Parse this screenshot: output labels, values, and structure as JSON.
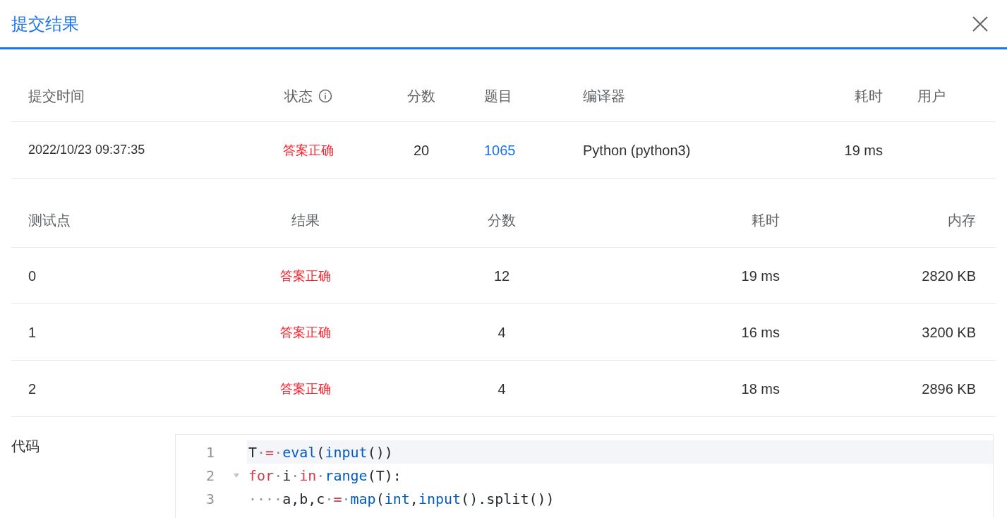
{
  "dialog": {
    "title": "提交结果"
  },
  "submission": {
    "columns": [
      {
        "label": "提交时间",
        "info": false
      },
      {
        "label": "状态",
        "info": true
      },
      {
        "label": "分数",
        "info": false
      },
      {
        "label": "题目",
        "info": false
      },
      {
        "label": "编译器",
        "info": false
      },
      {
        "label": "耗时",
        "info": false
      },
      {
        "label": "用户",
        "info": false
      }
    ],
    "row": {
      "time": "2022/10/23 09:37:35",
      "status": "答案正确",
      "score": "20",
      "problem": "1065",
      "compiler": "Python (python3)",
      "duration": "19 ms"
    }
  },
  "tests": {
    "columns": [
      "测试点",
      "结果",
      "分数",
      "耗时",
      "内存"
    ],
    "rows": [
      {
        "case": "0",
        "result": "答案正确",
        "score": "12",
        "time": "19 ms",
        "memory": "2820 KB"
      },
      {
        "case": "1",
        "result": "答案正确",
        "score": "4",
        "time": "16 ms",
        "memory": "3200 KB"
      },
      {
        "case": "2",
        "result": "答案正确",
        "score": "4",
        "time": "18 ms",
        "memory": "2896 KB"
      }
    ]
  },
  "code": {
    "label": "代码",
    "lines": [
      {
        "number": "1",
        "selected": true,
        "foldable": false,
        "tokens": [
          {
            "kind": "plain",
            "text": "T"
          },
          {
            "kind": "space",
            "text": "·"
          },
          {
            "kind": "op",
            "text": "="
          },
          {
            "kind": "space",
            "text": "·"
          },
          {
            "kind": "builtin",
            "text": "eval"
          },
          {
            "kind": "plain",
            "text": "("
          },
          {
            "kind": "builtin",
            "text": "input"
          },
          {
            "kind": "plain",
            "text": "())"
          }
        ]
      },
      {
        "number": "2",
        "selected": false,
        "foldable": true,
        "tokens": [
          {
            "kind": "keyword",
            "text": "for"
          },
          {
            "kind": "space",
            "text": "·"
          },
          {
            "kind": "plain",
            "text": "i"
          },
          {
            "kind": "space",
            "text": "·"
          },
          {
            "kind": "keyword",
            "text": "in"
          },
          {
            "kind": "space",
            "text": "·"
          },
          {
            "kind": "builtin",
            "text": "range"
          },
          {
            "kind": "plain",
            "text": "(T):"
          }
        ]
      },
      {
        "number": "3",
        "selected": false,
        "foldable": false,
        "tokens": [
          {
            "kind": "space",
            "text": "····"
          },
          {
            "kind": "plain",
            "text": "a,b,c"
          },
          {
            "kind": "space",
            "text": "·"
          },
          {
            "kind": "op",
            "text": "="
          },
          {
            "kind": "space",
            "text": "·"
          },
          {
            "kind": "builtin",
            "text": "map"
          },
          {
            "kind": "plain",
            "text": "("
          },
          {
            "kind": "builtin",
            "text": "int"
          },
          {
            "kind": "plain",
            "text": ","
          },
          {
            "kind": "builtin",
            "text": "input"
          },
          {
            "kind": "plain",
            "text": "().split())"
          }
        ]
      }
    ]
  }
}
